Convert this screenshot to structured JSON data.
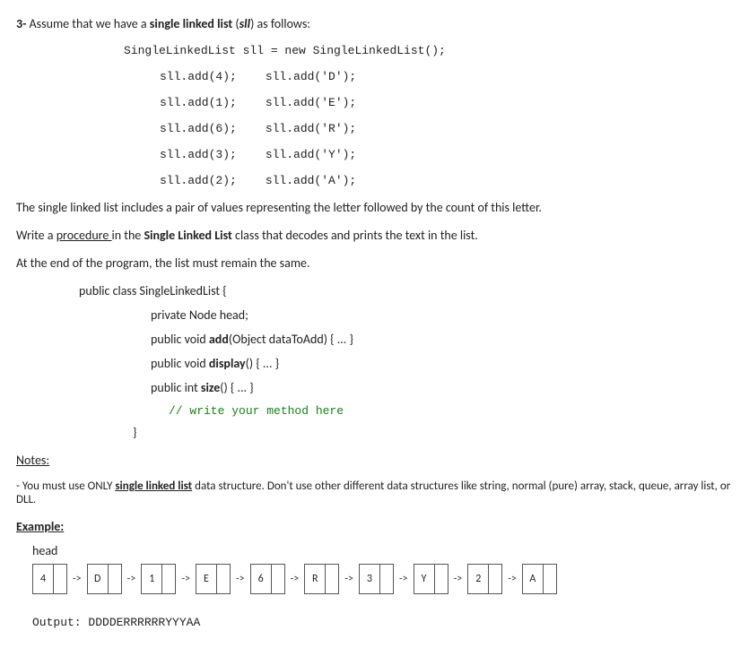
{
  "q": {
    "prefix": "3-",
    "lead": " Assume that we have a ",
    "bold1": "single linked list",
    "lead2": " (",
    "ital": "sll",
    "lead3": ") as follows:"
  },
  "code_init": "SingleLinkedList sll = new SingleLinkedList();",
  "pairs": [
    {
      "l": "sll.add(4);",
      "r": "sll.add('D');"
    },
    {
      "l": "sll.add(1);",
      "r": "sll.add('E');"
    },
    {
      "l": "sll.add(6);",
      "r": "sll.add('R');"
    },
    {
      "l": "sll.add(3);",
      "r": "sll.add('Y');"
    },
    {
      "l": "sll.add(2);",
      "r": "sll.add('A');"
    }
  ],
  "p1": "The single linked list includes a pair of values representing the letter followed by the count of this letter.",
  "p2": {
    "a": "Write a ",
    "u": "procedure ",
    "b": "in the ",
    "bold": "Single Linked List",
    "c": " class that decodes and prints the text in the list."
  },
  "p3": "At the end of the program, the list must remain the same.",
  "cls": {
    "open": "public class SingleLinkedList {",
    "f1": "private Node head;",
    "m1a": "public void ",
    "m1b": "add",
    "m1c": "(Object dataToAdd) { ... }",
    "m2a": "public void ",
    "m2b": "display",
    "m2c": "() { ... }",
    "m3a": "public int ",
    "m3b": "size",
    "m3c": "() { ... }",
    "comment": "// write your method here",
    "close": "}"
  },
  "notes_hdr": "Notes:",
  "note1a": "- You must use ONLY ",
  "note1u": "single linked list",
  "note1b": " data structure. Don't use other different data structures like string, normal (pure) array, stack, queue, array list, or DLL.",
  "example_hdr": "Example:",
  "head_label": "head",
  "arrow": "->",
  "chart_data": {
    "type": "table",
    "title": "Linked list node values",
    "nodes": [
      "4",
      "D",
      "1",
      "E",
      "6",
      "R",
      "3",
      "Y",
      "2",
      "A"
    ]
  },
  "output_label": "Output: ",
  "output_value": "DDDDERRRRRRYYYAA"
}
